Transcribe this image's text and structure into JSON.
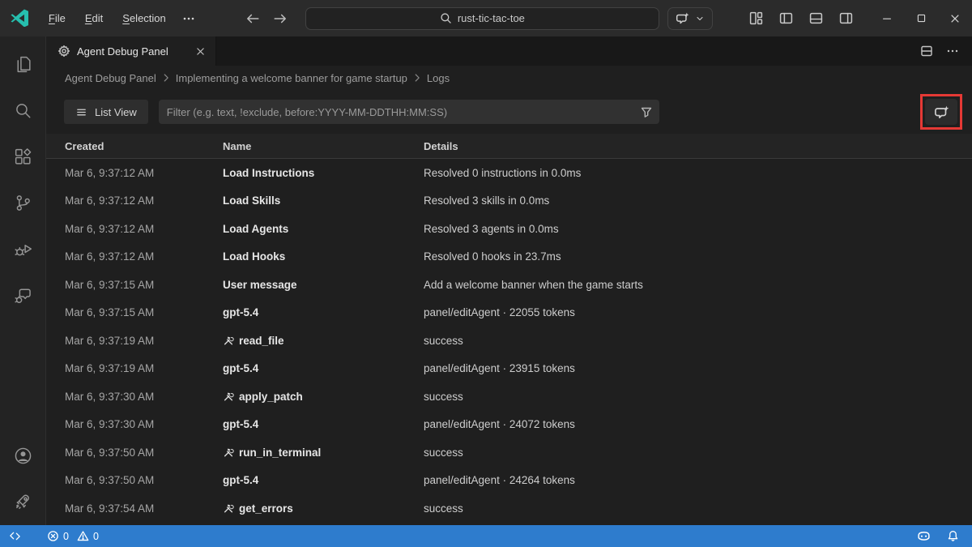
{
  "titlebar": {
    "menus": [
      "File",
      "Edit",
      "Selection"
    ],
    "search_value": "rust-tic-tac-toe"
  },
  "tab": {
    "title": "Agent Debug Panel"
  },
  "breadcrumb": {
    "items": [
      "Agent Debug Panel",
      "Implementing a welcome banner for game startup",
      "Logs"
    ]
  },
  "toolbar": {
    "list_view_label": "List View",
    "filter_placeholder": "Filter (e.g. text, !exclude, before:YYYY-MM-DDTHH:MM:SS)"
  },
  "table": {
    "columns": [
      "Created",
      "Name",
      "Details"
    ],
    "rows": [
      {
        "created": "Mar 6, 9:37:12 AM",
        "name": "Load Instructions",
        "tool": false,
        "details": "Resolved 0 instructions in 0.0ms"
      },
      {
        "created": "Mar 6, 9:37:12 AM",
        "name": "Load Skills",
        "tool": false,
        "details": "Resolved 3 skills in 0.0ms"
      },
      {
        "created": "Mar 6, 9:37:12 AM",
        "name": "Load Agents",
        "tool": false,
        "details": "Resolved 3 agents in 0.0ms"
      },
      {
        "created": "Mar 6, 9:37:12 AM",
        "name": "Load Hooks",
        "tool": false,
        "details": "Resolved 0 hooks in 23.7ms"
      },
      {
        "created": "Mar 6, 9:37:15 AM",
        "name": "User message",
        "tool": false,
        "details": "Add a welcome banner when the game starts"
      },
      {
        "created": "Mar 6, 9:37:15 AM",
        "name": "gpt-5.4",
        "tool": false,
        "details": "panel/editAgent · 22055 tokens"
      },
      {
        "created": "Mar 6, 9:37:19 AM",
        "name": "read_file",
        "tool": true,
        "details": "success"
      },
      {
        "created": "Mar 6, 9:37:19 AM",
        "name": "gpt-5.4",
        "tool": false,
        "details": "panel/editAgent · 23915 tokens"
      },
      {
        "created": "Mar 6, 9:37:30 AM",
        "name": "apply_patch",
        "tool": true,
        "details": "success"
      },
      {
        "created": "Mar 6, 9:37:30 AM",
        "name": "gpt-5.4",
        "tool": false,
        "details": "panel/editAgent · 24072 tokens"
      },
      {
        "created": "Mar 6, 9:37:50 AM",
        "name": "run_in_terminal",
        "tool": true,
        "details": "success"
      },
      {
        "created": "Mar 6, 9:37:50 AM",
        "name": "gpt-5.4",
        "tool": false,
        "details": "panel/editAgent · 24264 tokens"
      },
      {
        "created": "Mar 6, 9:37:54 AM",
        "name": "get_errors",
        "tool": true,
        "details": "success"
      }
    ]
  },
  "activity_bar": {
    "top": [
      "explorer",
      "search",
      "extensions",
      "source-control",
      "run-and-debug",
      "chat"
    ],
    "bottom": [
      "accounts",
      "rocket"
    ]
  },
  "status_bar": {
    "errors": "0",
    "warnings": "0"
  },
  "colors": {
    "status_bar_blue": "#2e7ccd",
    "annotation_red": "#e53935",
    "logo_teal": "#26bfae"
  }
}
